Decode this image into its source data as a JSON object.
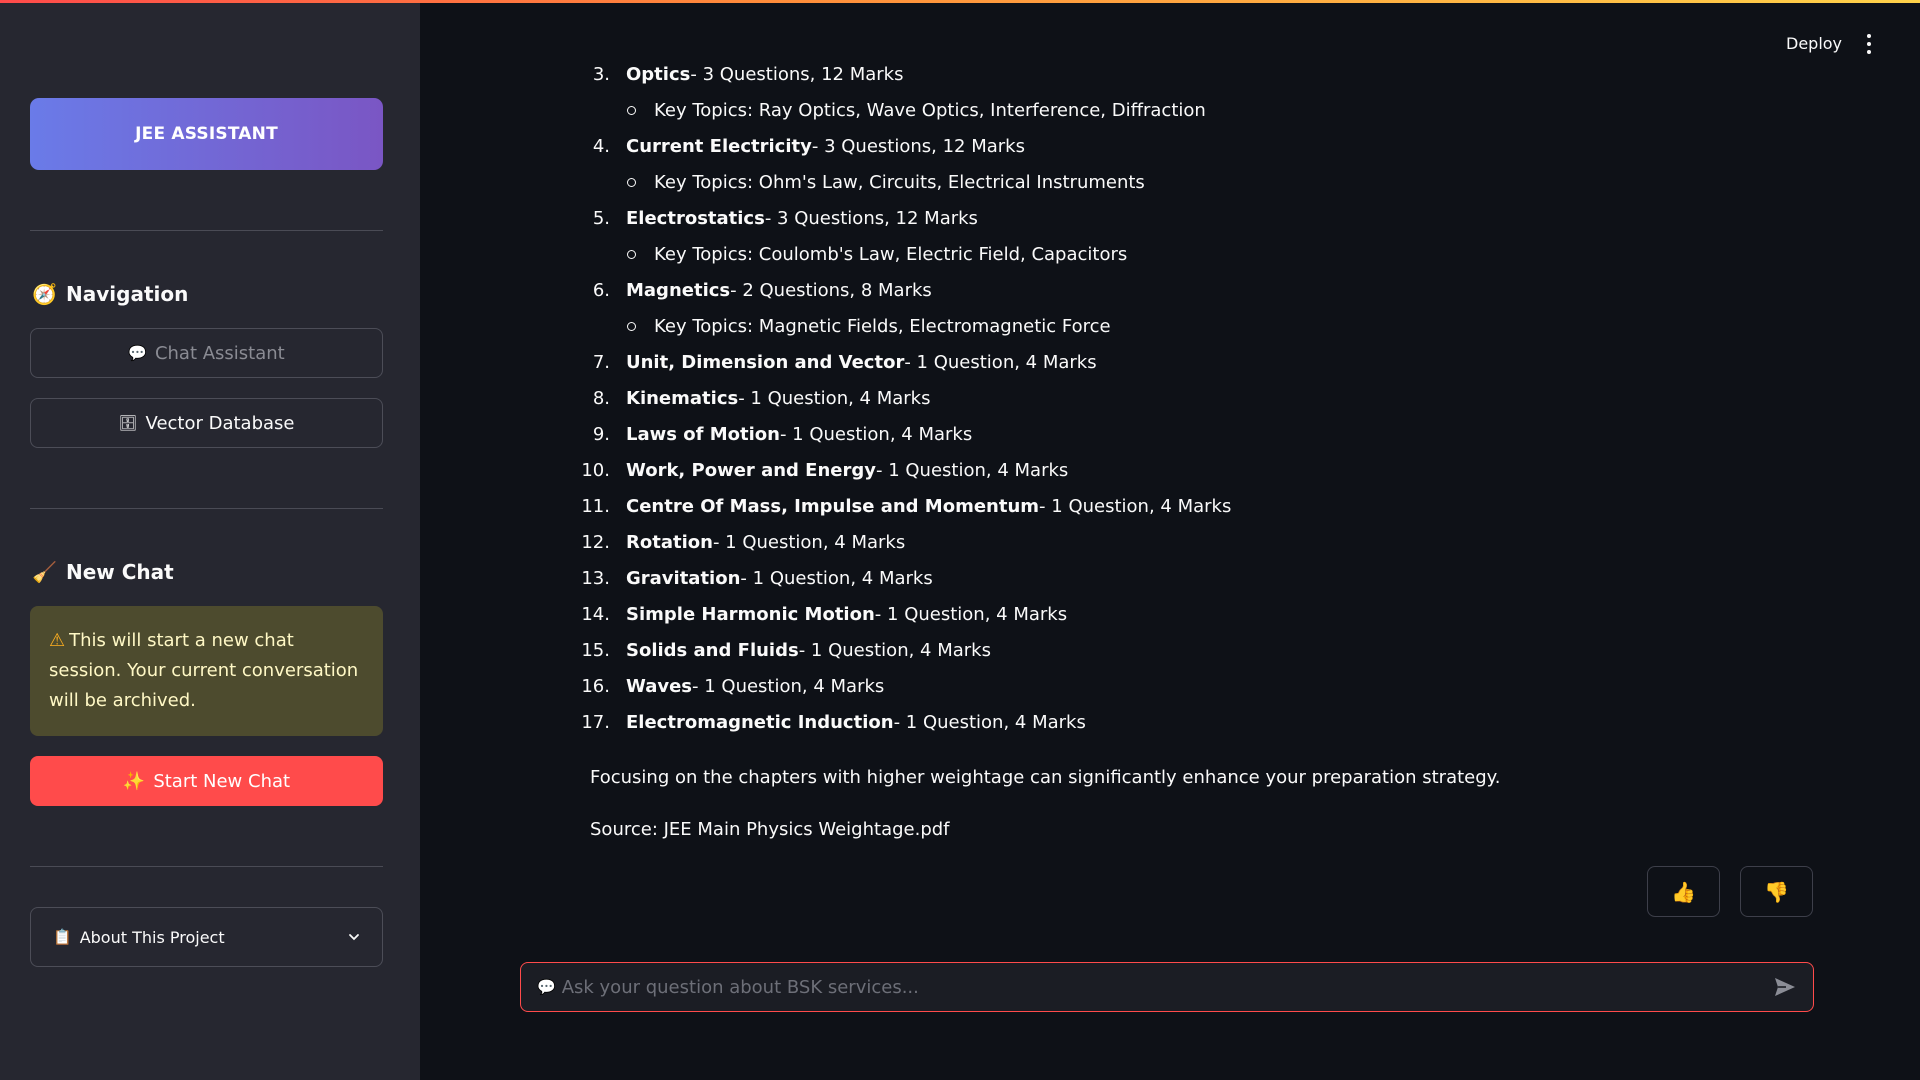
{
  "sidebar": {
    "brand": "JEE ASSISTANT",
    "navigation_heading": "Navigation",
    "navigation_icon": "compass-icon",
    "nav_items": [
      {
        "icon": "speech-bubble-icon",
        "label": "Chat Assistant",
        "state": "active-disabled"
      },
      {
        "icon": "database-icon",
        "label": "Vector Database",
        "state": "normal"
      }
    ],
    "new_chat_heading": "New Chat",
    "new_chat_icon": "broom-icon",
    "warning_icon": "warning-icon",
    "warning_text": "This will start a new chat session. Your current conversation will be archived.",
    "start_button_label": "Start New Chat",
    "start_button_icon": "sparkles-icon",
    "about_label": "About This Project",
    "about_icon": "clipboard-icon"
  },
  "header": {
    "deploy_label": "Deploy"
  },
  "message": {
    "items": [
      {
        "num": "3.",
        "title": "Optics",
        "rest": " - 3 Questions, 12 Marks",
        "sub": "Key Topics: Ray Optics, Wave Optics, Interference, Diffraction"
      },
      {
        "num": "4.",
        "title": "Current Electricity",
        "rest": " - 3 Questions, 12 Marks",
        "sub": "Key Topics: Ohm's Law, Circuits, Electrical Instruments"
      },
      {
        "num": "5.",
        "title": "Electrostatics",
        "rest": " - 3 Questions, 12 Marks",
        "sub": "Key Topics: Coulomb's Law, Electric Field, Capacitors"
      },
      {
        "num": "6.",
        "title": "Magnetics",
        "rest": " - 2 Questions, 8 Marks",
        "sub": "Key Topics: Magnetic Fields, Electromagnetic Force"
      },
      {
        "num": "7.",
        "title": "Unit, Dimension and Vector",
        "rest": " - 1 Question, 4 Marks"
      },
      {
        "num": "8.",
        "title": "Kinematics",
        "rest": " - 1 Question, 4 Marks"
      },
      {
        "num": "9.",
        "title": "Laws of Motion",
        "rest": " - 1 Question, 4 Marks"
      },
      {
        "num": "10.",
        "title": "Work, Power and Energy",
        "rest": " - 1 Question, 4 Marks"
      },
      {
        "num": "11.",
        "title": "Centre Of Mass, Impulse and Momentum",
        "rest": " - 1 Question, 4 Marks"
      },
      {
        "num": "12.",
        "title": "Rotation",
        "rest": " - 1 Question, 4 Marks"
      },
      {
        "num": "13.",
        "title": "Gravitation",
        "rest": " - 1 Question, 4 Marks"
      },
      {
        "num": "14.",
        "title": "Simple Harmonic Motion",
        "rest": " - 1 Question, 4 Marks"
      },
      {
        "num": "15.",
        "title": "Solids and Fluids",
        "rest": " - 1 Question, 4 Marks"
      },
      {
        "num": "16.",
        "title": "Waves",
        "rest": " - 1 Question, 4 Marks"
      },
      {
        "num": "17.",
        "title": "Electromagnetic Induction",
        "rest": " - 1 Question, 4 Marks"
      }
    ],
    "summary": "Focusing on the chapters with higher weightage can significantly enhance your preparation strategy.",
    "source": "Source: JEE Main Physics Weightage.pdf"
  },
  "feedback": {
    "thumbs_up_icon": "thumbs-up-icon",
    "thumbs_down_icon": "thumbs-down-icon"
  },
  "chat_input": {
    "placeholder": "Ask your question about BSK services...",
    "value": ""
  },
  "colors": {
    "accent": "#ff4b4b",
    "sidebar_bg": "#262730",
    "main_bg": "#0e1117",
    "brand_gradient_start": "#6a7be8",
    "brand_gradient_end": "#7a56c4",
    "warning_bg": "#4d4b2e"
  }
}
